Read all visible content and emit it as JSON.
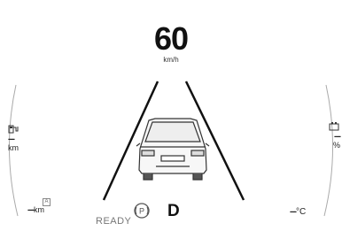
{
  "speed": {
    "value": "60",
    "unit": "km/h"
  },
  "left_side": {
    "icon": "fuel-gauge-icon",
    "value": "---",
    "unit": "km"
  },
  "right_side": {
    "icon": "battery-icon",
    "value": "---",
    "unit": "%"
  },
  "range": {
    "icon": "small-indicator-icon",
    "value": "---",
    "unit": "km"
  },
  "temperature": {
    "value": "---",
    "unit": "°C"
  },
  "status": {
    "ready": "READY",
    "gear": "D"
  },
  "colors": {
    "foreground": "#111111",
    "muted": "#777777",
    "background": "#ffffff"
  }
}
